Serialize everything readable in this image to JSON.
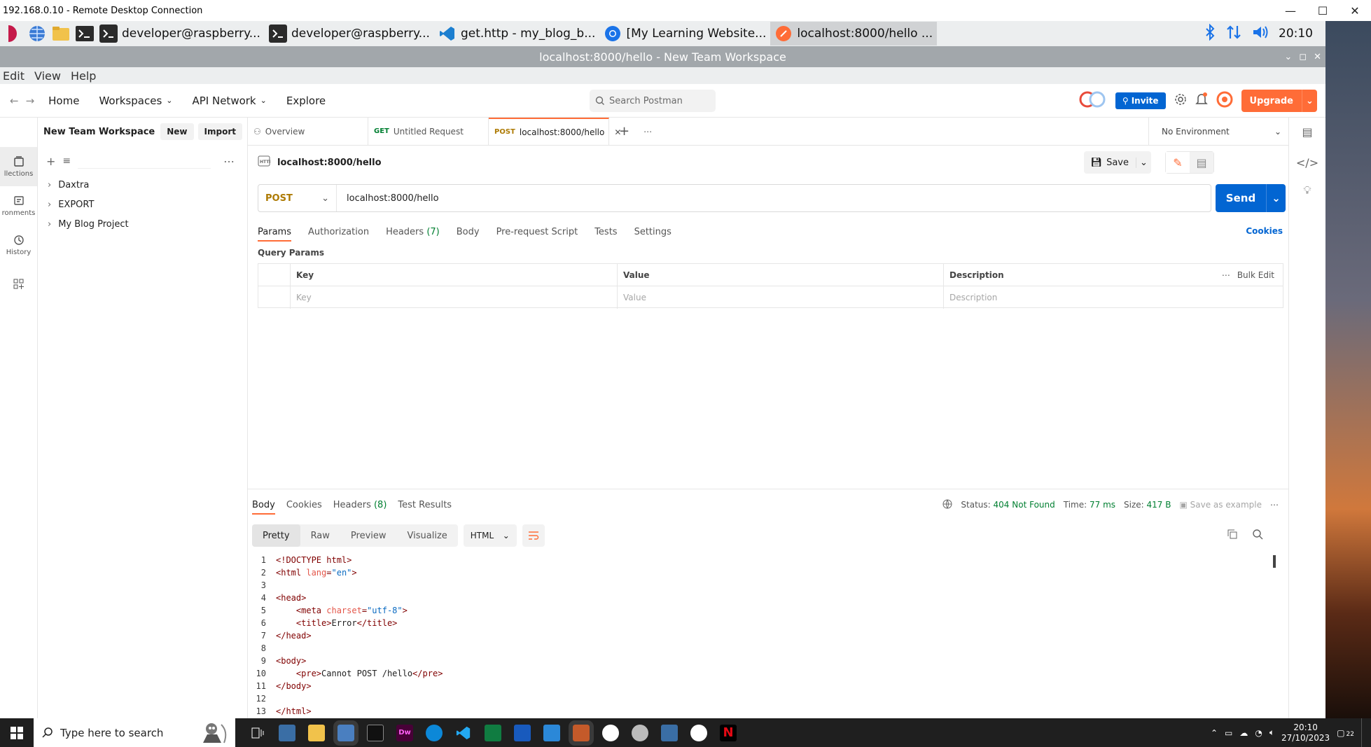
{
  "rdp": {
    "title": "192.168.0.10 - Remote Desktop Connection"
  },
  "pi_taskbar": {
    "tasks": [
      {
        "label": "developer@raspberry..."
      },
      {
        "label": "developer@raspberry..."
      },
      {
        "label": "get.http - my_blog_b..."
      },
      {
        "label": "[My Learning Website..."
      },
      {
        "label": "localhost:8000/hello ..."
      }
    ],
    "clock": "20:10"
  },
  "postman_window": {
    "title": "localhost:8000/hello - New Team Workspace"
  },
  "menubar": {
    "items": [
      "Edit",
      "View",
      "Help"
    ]
  },
  "header": {
    "nav": [
      "Home",
      "Workspaces",
      "API Network",
      "Explore"
    ],
    "search_placeholder": "Search Postman",
    "invite": "Invite",
    "upgrade": "Upgrade"
  },
  "rail": {
    "items": [
      {
        "label": "llections"
      },
      {
        "label": "ronments"
      },
      {
        "label": "History"
      }
    ]
  },
  "sidebar": {
    "workspace": "New Team Workspace",
    "new_btn": "New",
    "import_btn": "Import",
    "collections": [
      "Daxtra",
      "EXPORT",
      "My Blog Project"
    ]
  },
  "tabs": {
    "overview": "Overview",
    "untitled_method": "GET",
    "untitled_label": "Untitled Request",
    "active_method": "POST",
    "active_label": "localhost:8000/hello",
    "environment": "No Environment"
  },
  "request": {
    "name": "localhost:8000/hello",
    "save": "Save",
    "method": "POST",
    "url": "localhost:8000/hello",
    "send": "Send",
    "tabs": [
      "Params",
      "Authorization",
      "Headers",
      "Body",
      "Pre-request Script",
      "Tests",
      "Settings"
    ],
    "headers_count": "(7)",
    "cookies": "Cookies",
    "query_params_title": "Query Params",
    "table": {
      "headers": [
        "Key",
        "Value",
        "Description"
      ],
      "bulk_edit": "Bulk Edit",
      "placeholders": [
        "Key",
        "Value",
        "Description"
      ]
    }
  },
  "response": {
    "tabs": [
      "Body",
      "Cookies",
      "Headers",
      "Test Results"
    ],
    "headers_count": "(8)",
    "status_label": "Status:",
    "status_value": "404 Not Found",
    "time_label": "Time:",
    "time_value": "77 ms",
    "size_label": "Size:",
    "size_value": "417 B",
    "save_example": "Save as example",
    "formats": [
      "Pretty",
      "Raw",
      "Preview",
      "Visualize"
    ],
    "language": "HTML",
    "code_lines": [
      "<!DOCTYPE html>",
      "<html lang=\"en\">",
      "",
      "<head>",
      "    <meta charset=\"utf-8\">",
      "    <title>Error</title>",
      "</head>",
      "",
      "<body>",
      "    <pre>Cannot POST /hello</pre>",
      "</body>",
      "",
      "</html>"
    ]
  },
  "win_taskbar": {
    "search_placeholder": "Type here to search",
    "icon_labels": [
      "Dw"
    ],
    "time": "20:10",
    "date": "27/10/2023",
    "notif_count": "22"
  },
  "colors": {
    "accent": "#ff6c37",
    "primary": "#0265d2",
    "get": "#007f31",
    "post": "#ad7a03"
  }
}
